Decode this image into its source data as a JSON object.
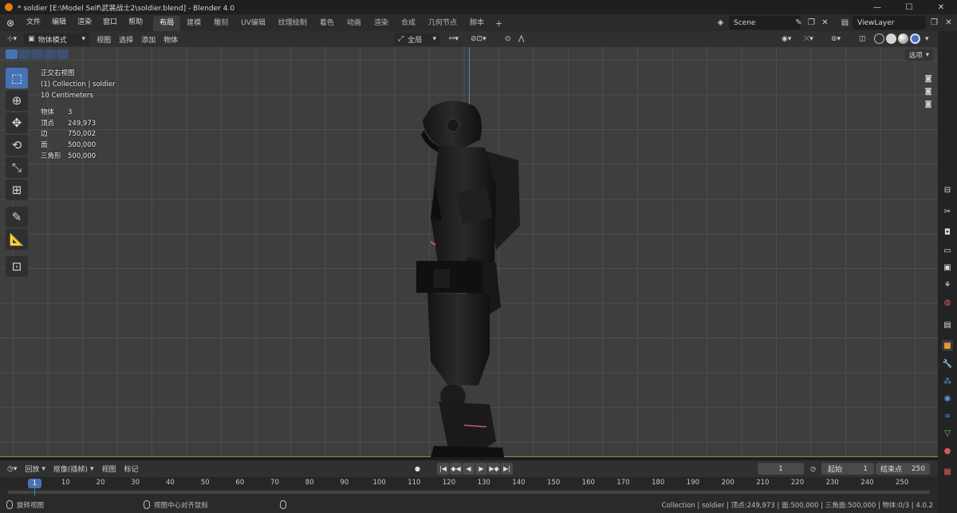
{
  "window": {
    "title": "* soldier [E:\\Model Self\\武装战士2\\soldier.blend] - Blender 4.0",
    "minimize_glyph": "—",
    "maximize_glyph": "☐",
    "close_glyph": "✕"
  },
  "menu": [
    "文件",
    "编辑",
    "渲染",
    "窗口",
    "帮助"
  ],
  "workspaces": [
    "布局",
    "建模",
    "雕刻",
    "UV编辑",
    "纹理绘制",
    "着色",
    "动画",
    "渲染",
    "合成",
    "几何节点",
    "脚本"
  ],
  "active_workspace": "布局",
  "scene": {
    "name": "Scene"
  },
  "view_layer": {
    "name": "ViewLayer"
  },
  "viewport_header": {
    "mode": "物体模式",
    "menus": [
      "视图",
      "选择",
      "添加",
      "物体"
    ],
    "transform_orientation": "全局"
  },
  "viewport": {
    "options_label": "选项",
    "view_name": "正交右视图",
    "collection_line": "(1) Collection | soldier",
    "scale": "10 Centimeters",
    "stats": [
      {
        "label": "物体",
        "value": "3"
      },
      {
        "label": "顶点",
        "value": "249,973"
      },
      {
        "label": "边",
        "value": "750,002"
      },
      {
        "label": "面",
        "value": "500,000"
      },
      {
        "label": "三角形",
        "value": "500,000"
      }
    ]
  },
  "timeline": {
    "menus": [
      "回放",
      "抠像(插帧)",
      "视图",
      "标记"
    ],
    "current_frame": "1",
    "start_label": "起始",
    "start_value": "1",
    "end_label": "结束点",
    "end_value": "250",
    "ruler": [
      "1",
      "10",
      "20",
      "30",
      "40",
      "50",
      "60",
      "70",
      "80",
      "90",
      "100",
      "110",
      "120",
      "130",
      "140",
      "150",
      "160",
      "170",
      "180",
      "190",
      "200",
      "210",
      "220",
      "230",
      "240",
      "250"
    ]
  },
  "statusbar": {
    "hint1": "旋转视图",
    "hint2": "视图中心对齐鼠标",
    "info": "Collection | soldier | 顶点:249,973 | 面:500,000 | 三角面:500,000 | 物体:0/3 | 4.0.2"
  },
  "colors": {
    "accent": "#4772b3",
    "y_axis": "#4a8ec8",
    "ground": "#7a9a3a",
    "app_orange": "#e87d0d"
  }
}
